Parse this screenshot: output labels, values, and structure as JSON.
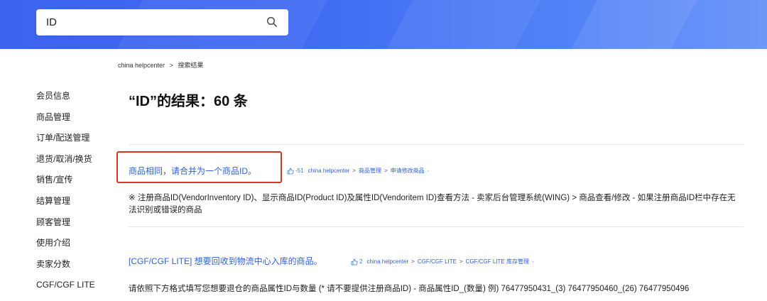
{
  "header": {
    "search": {
      "value": "ID",
      "placeholder": ""
    },
    "colors": {
      "gradient_start": "#3b63ee",
      "gradient_end": "#6e98f8"
    }
  },
  "breadcrumb": {
    "home": "china helpcenter",
    "separator": ">",
    "current": "搜索结果"
  },
  "sidebar": {
    "items": [
      {
        "label": "会员信息"
      },
      {
        "label": "商品管理"
      },
      {
        "label": "订单/配送管理"
      },
      {
        "label": "退货/取消/换货"
      },
      {
        "label": "销售/宣传"
      },
      {
        "label": "结算管理"
      },
      {
        "label": "顾客管理"
      },
      {
        "label": "使用介绍"
      },
      {
        "label": "卖家分数"
      },
      {
        "label": "CGF/CGF LITE"
      }
    ]
  },
  "results": {
    "title": "“ID”的结果：60 条",
    "highlight_color": "#e0331f",
    "items": [
      {
        "title": "商品相同，请合并为一个商品ID。",
        "likes": "-51",
        "path": [
          "china helpcenter",
          "商品管理",
          "申请修改商品"
        ],
        "snippet": "※ 注册商品ID(VendorInventory ID)、显示商品ID(Product ID)及属性ID(Vendoritem ID)查看方法 - 卖家后台管理系统(WING) > 商品查看/修改 - 如果注册商品ID栏中存在无法识别或错误的商品"
      },
      {
        "title": "[CGF/CGF LITE] 想要回收到物流中心入库的商品。",
        "likes": "2",
        "path": [
          "china helpcenter",
          "CGF/CGF LITE",
          "CGF/CGF LITE 库存管理"
        ],
        "snippet": "请依照下方格式填写您想要退仓的商品属性ID与数量 (* 请不要提供注册商品ID) - 商品属性ID_(数量) 例) 76477950431_(3) 76477950460_(26) 76477950496"
      }
    ],
    "meta_separator": ">",
    "meta_dot": "·"
  }
}
